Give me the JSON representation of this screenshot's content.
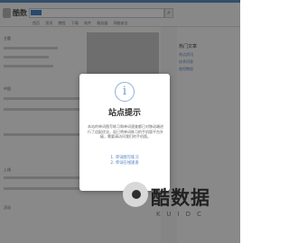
{
  "header": {
    "site_name": "酷数",
    "search_placeholder": "",
    "search_icon": "magnifier-icon",
    "nav_links": [
      "首页",
      "资讯",
      "教程",
      "下载",
      "软件",
      "服务器",
      "网络安全"
    ]
  },
  "main": {
    "labels": [
      "主题",
      "中国",
      "上线",
      "活动"
    ]
  },
  "sidebar": {
    "heading": "热门文章",
    "links": [
      "热点资讯",
      "技术问答",
      "使用教程"
    ]
  },
  "modal": {
    "icon": "info-icon",
    "icon_glyph": "i",
    "title": "站点提示",
    "body": "本站的单词图写练习和单词速查都已对移动端进行了适配优化，现已将单词练习的手机版平台升级，需要请访问我们的手机版。",
    "links": [
      "1.  单词图写练习",
      "2.  单词在线速查"
    ]
  },
  "watermark": {
    "title": "酷数据",
    "subtitle": "KUIDC"
  }
}
